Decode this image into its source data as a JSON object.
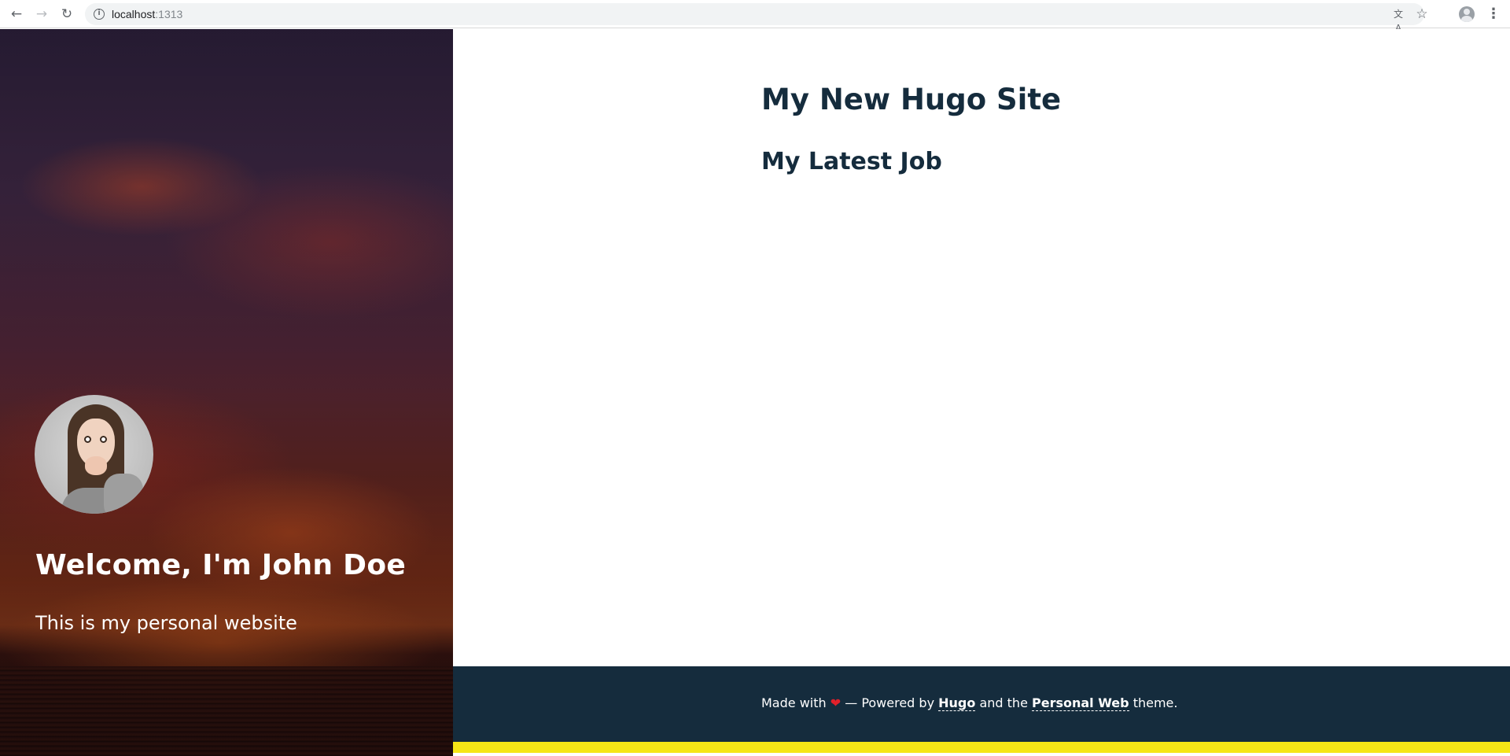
{
  "browser": {
    "url_host": "localhost",
    "url_port": ":1313",
    "back_glyph": "←",
    "forward_glyph": "→",
    "reload_glyph": "↻",
    "info_glyph": "i",
    "translate_glyph": "文A",
    "star_glyph": "☆",
    "menu_glyph": "⋮"
  },
  "hero": {
    "title": "Welcome, I'm John Doe",
    "subtitle": "This is my personal website"
  },
  "main": {
    "site_title": "My New Hugo Site",
    "section_title": "My Latest Job"
  },
  "footer": {
    "made_with": "Made with",
    "heart": "❤",
    "powered_by": " — Powered by ",
    "hugo_link": "Hugo",
    "and_the": " and the ",
    "theme_link": "Personal Web",
    "theme_suffix": " theme."
  },
  "colors": {
    "dark_navy": "#152c3d",
    "accent_yellow": "#f5e616",
    "heart_red": "#e0202a"
  }
}
